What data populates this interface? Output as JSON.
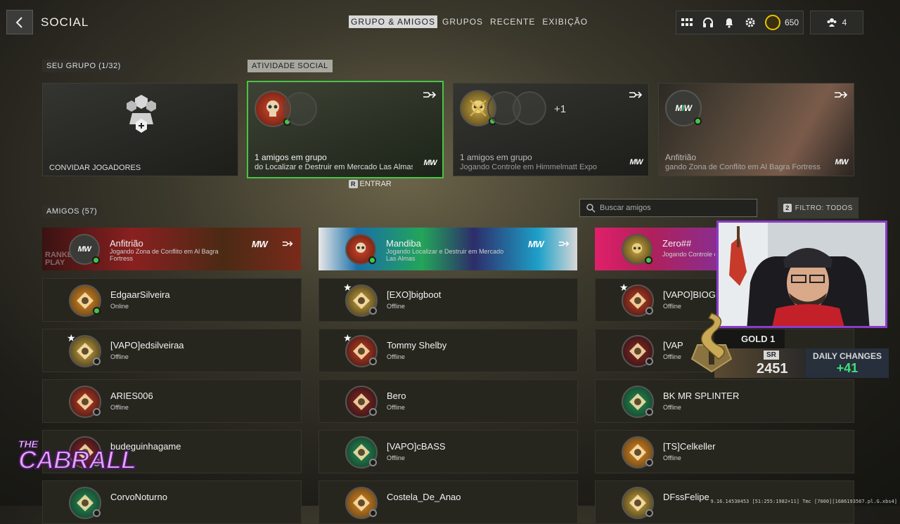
{
  "header": {
    "title": "SOCIAL",
    "coin_value": "650",
    "party_count": "4"
  },
  "tabs": [
    {
      "label": "GRUPO & AMIGOS",
      "active": true
    },
    {
      "label": "GRUPOS",
      "active": false
    },
    {
      "label": "RECENTE",
      "active": false
    },
    {
      "label": "EXIBIÇÃO",
      "active": false
    }
  ],
  "sections": {
    "group": "SEU GRUPO (1/32)",
    "social": "ATIVIDADE SOCIAL",
    "friends": "AMIGOS (57)"
  },
  "invite_label": "CONVIDAR JOGADORES",
  "social_cards": [
    {
      "line1": "1 amigos em grupo",
      "line2": "do Localizar e Destruir em Mercado Las Almas",
      "logo": "MW",
      "extra": ""
    },
    {
      "line1": "1 amigos em grupo",
      "line2": "Jogando Controle em Himmelmatt Expo",
      "logo": "MW",
      "extra": "+1"
    },
    {
      "line1": "Anfitrião",
      "line2": "gando Zona de Conflito em Al Bagra Fortress",
      "logo": "MW",
      "extra": ""
    }
  ],
  "join_key": "R",
  "join_label": "ENTRAR",
  "search_placeholder": "Buscar amigos",
  "filter": {
    "key": "2",
    "label": "FILTRO: TODOS"
  },
  "featured": [
    {
      "name": "Anfitrião",
      "activity": "Jogando Zona de Conflito em Al Bagra Fortress",
      "color": "#8a2020",
      "watermark": "RANKED PLAY"
    },
    {
      "name": "Mandiba",
      "activity": "Jogando Localizar e Destruir em Mercado Las Almas",
      "color": "#2a4f7a",
      "watermark": ""
    },
    {
      "name": "Zero##",
      "activity": "Jogando Controle e",
      "color": "#b0205a",
      "watermark": ""
    }
  ],
  "friends": [
    [
      {
        "name": "EdgaarSilveira",
        "status": "Online",
        "star": false,
        "online": true
      },
      {
        "name": "[VAPO]edsilveiraa",
        "status": "Offline",
        "star": true,
        "online": false
      },
      {
        "name": "ARIES006",
        "status": "Offline",
        "star": false,
        "online": false
      },
      {
        "name": "budeguinhagame",
        "status": "",
        "star": false,
        "online": false
      },
      {
        "name": "CorvoNoturno",
        "status": "",
        "star": false,
        "online": false
      }
    ],
    [
      {
        "name": "[EXO]bigboot",
        "status": "Offline",
        "star": true,
        "online": false
      },
      {
        "name": "Tommy Shelby",
        "status": "Offline",
        "star": true,
        "online": false
      },
      {
        "name": "Bero",
        "status": "Offline",
        "star": false,
        "online": false
      },
      {
        "name": "[VAPO]cBASS",
        "status": "Offline",
        "star": false,
        "online": false
      },
      {
        "name": "Costela_De_Anao",
        "status": "",
        "star": false,
        "online": false
      }
    ],
    [
      {
        "name": "[VAPO]BIOGF",
        "status": "Offline",
        "star": true,
        "online": false
      },
      {
        "name": "[VAP",
        "status": "Offline",
        "star": false,
        "online": false
      },
      {
        "name": "BK MR SPLINTER",
        "status": "Offline",
        "star": false,
        "online": false
      },
      {
        "name": "[TS]Celkeller",
        "status": "Offline",
        "star": false,
        "online": false
      },
      {
        "name": "DFssFelipe",
        "status": "",
        "star": false,
        "online": false
      }
    ]
  ],
  "overlay": {
    "rank": "GOLD 1",
    "sr_label": "SR",
    "sr_value": "2451",
    "daily_label": "DAILY CHANGES",
    "daily_value": "+41",
    "brand_top": "THE",
    "brand_main": "CABRALL"
  },
  "version": "9.16.14530453 [51:255:1982+11] Tmc [7000][1686193567.pl.G.xbs4]",
  "colors": {
    "online": "#45c545",
    "selected_border": "#47c447",
    "daily_value": "#3fe07a",
    "brand": "#e7a4f2"
  }
}
